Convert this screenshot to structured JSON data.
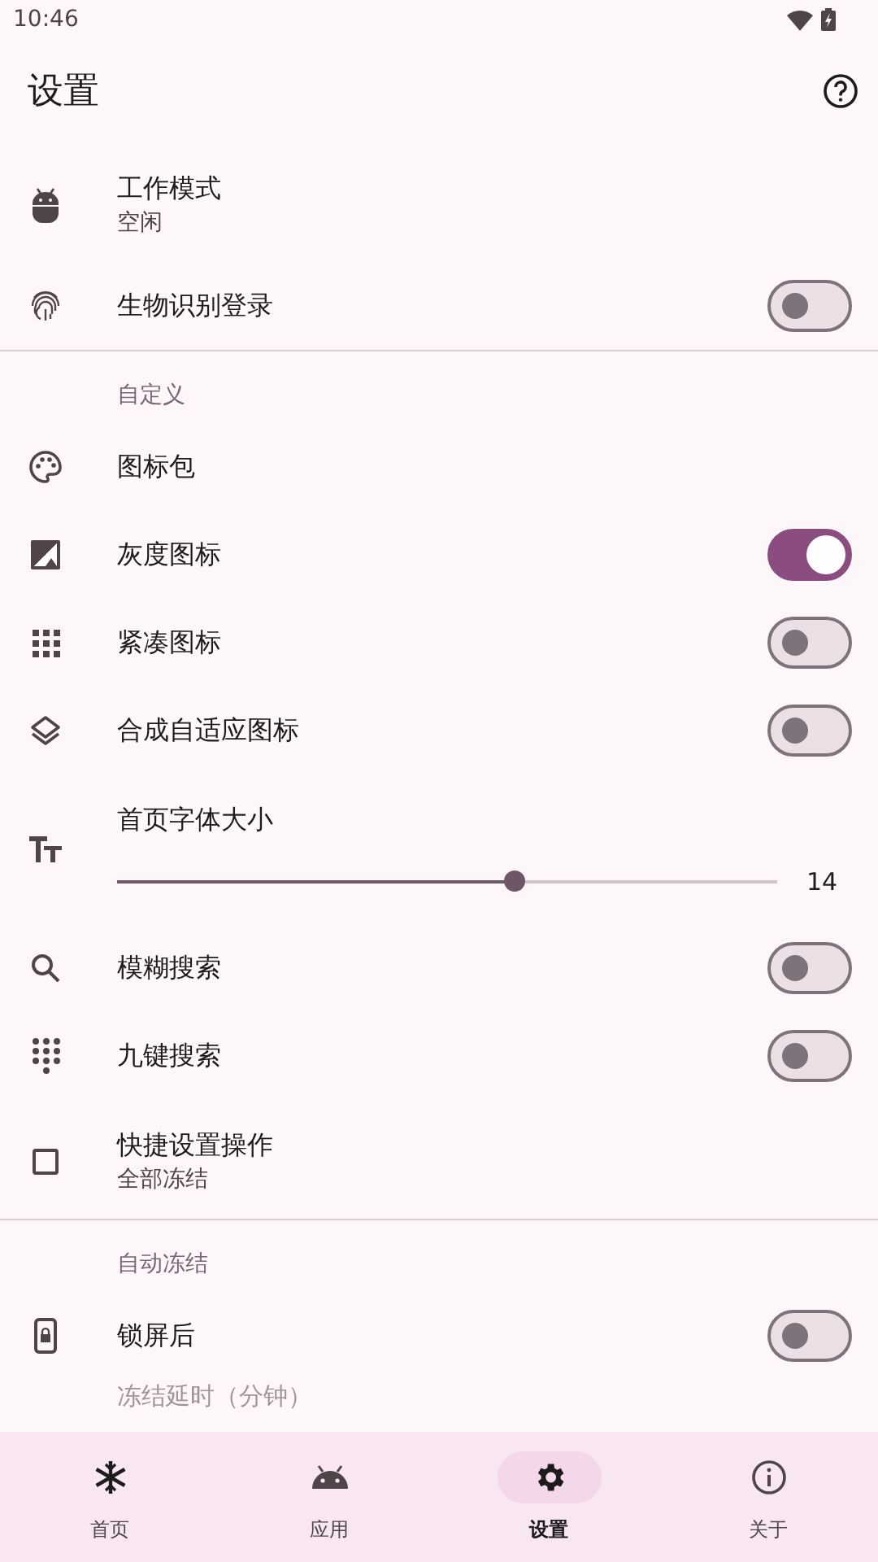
{
  "status_bar": {
    "time": "10:46"
  },
  "app_bar": {
    "title": "设置"
  },
  "settings": [
    {
      "kind": "two-line",
      "title": "工作模式",
      "summary": "空闲"
    },
    {
      "kind": "switch",
      "title": "生物识别登录",
      "on": false
    },
    {
      "kind": "divider"
    },
    {
      "kind": "header",
      "title": "自定义"
    },
    {
      "kind": "plain",
      "title": "图标包"
    },
    {
      "kind": "switch",
      "title": "灰度图标",
      "on": true
    },
    {
      "kind": "switch",
      "title": "紧凑图标",
      "on": false
    },
    {
      "kind": "switch",
      "title": "合成自适应图标",
      "on": false
    },
    {
      "kind": "slider",
      "title": "首页字体大小",
      "level": 0.6,
      "reading": "14"
    },
    {
      "kind": "switch",
      "title": "模糊搜索",
      "on": false
    },
    {
      "kind": "switch",
      "title": "九键搜索",
      "on": false
    },
    {
      "kind": "two-line",
      "title": "快捷设置操作",
      "summary": "全部冻结"
    },
    {
      "kind": "divider"
    },
    {
      "kind": "header",
      "title": "自动冻结"
    },
    {
      "kind": "switch",
      "title": "锁屏后",
      "on": false
    },
    {
      "kind": "cut",
      "title": "冻结延时（分钟）"
    }
  ],
  "nav": [
    {
      "label": "首页",
      "selected": false
    },
    {
      "label": "应用",
      "selected": false
    },
    {
      "label": "设置",
      "selected": true
    },
    {
      "label": "关于",
      "selected": false
    }
  ]
}
